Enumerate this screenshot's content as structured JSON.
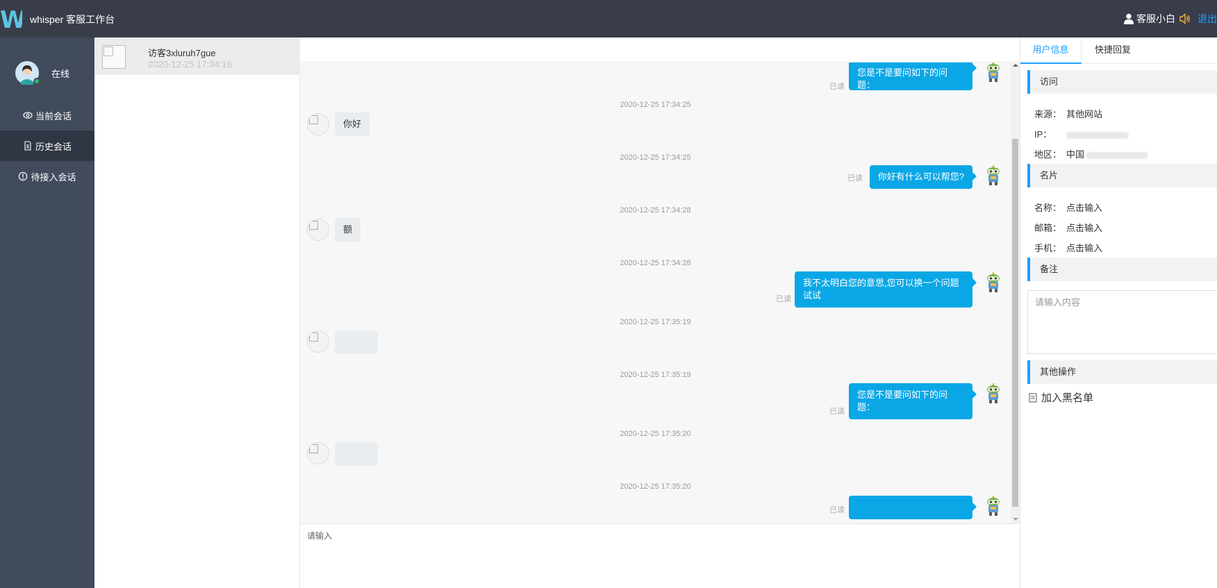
{
  "topbar": {
    "logo_letter": "W",
    "title": "whisper 客服工作台",
    "username": "客服小白",
    "logout": "退出"
  },
  "leftnav": {
    "status": "在线",
    "items": [
      {
        "label": "当前会话",
        "icon": "eye-icon"
      },
      {
        "label": "历史会话",
        "icon": "document-icon"
      },
      {
        "label": "待接入会话",
        "icon": "info-icon"
      }
    ]
  },
  "sessions": [
    {
      "name": "访客3xluruh7gue",
      "time": "2020-12-25 17:34:16"
    }
  ],
  "chat": {
    "read_label": "已读",
    "messages": [
      {
        "time": "",
        "from": "agent",
        "text": "您是不是要问如下的问题："
      },
      {
        "time": "2020-12-25 17:34:25",
        "from": "visitor",
        "text": "你好"
      },
      {
        "time": "2020-12-25 17:34:25",
        "from": "agent",
        "text": "你好有什么可以帮您?"
      },
      {
        "time": "2020-12-25 17:34:28",
        "from": "visitor",
        "text": "额"
      },
      {
        "time": "2020-12-25 17:34:28",
        "from": "agent",
        "text_line1": "我不太明白您的意思,您可以换一个问题",
        "text_line2": "试试"
      },
      {
        "time": "2020-12-25 17:35:19",
        "from": "visitor",
        "text": ""
      },
      {
        "time": "2020-12-25 17:35:19",
        "from": "agent",
        "text": "您是不是要问如下的问题："
      },
      {
        "time": "2020-12-25 17:35:20",
        "from": "visitor",
        "text": ""
      },
      {
        "time": "2020-12-25 17:35:20",
        "from": "agent",
        "text": ""
      }
    ],
    "input_placeholder": "请输入"
  },
  "rightpanel": {
    "tabs": [
      "用户信息",
      "快捷回复"
    ],
    "visit": {
      "title": "访问",
      "source_label": "来源：",
      "source_value": "其他网站",
      "ip_label": "IP：",
      "region_label": "地区：",
      "region_value": "中国"
    },
    "card": {
      "title": "名片",
      "name_label": "名称：",
      "email_label": "邮箱：",
      "phone_label": "手机：",
      "placeholder": "点击输入"
    },
    "remark": {
      "title": "备注",
      "placeholder": "请输入内容"
    },
    "other": {
      "title": "其他操作",
      "blacklist": "加入黑名单"
    }
  },
  "colors": {
    "topbar": "#393d49",
    "nav": "#414b5c",
    "accent": "#1e9fff",
    "bubble": "#0aa7e6"
  }
}
